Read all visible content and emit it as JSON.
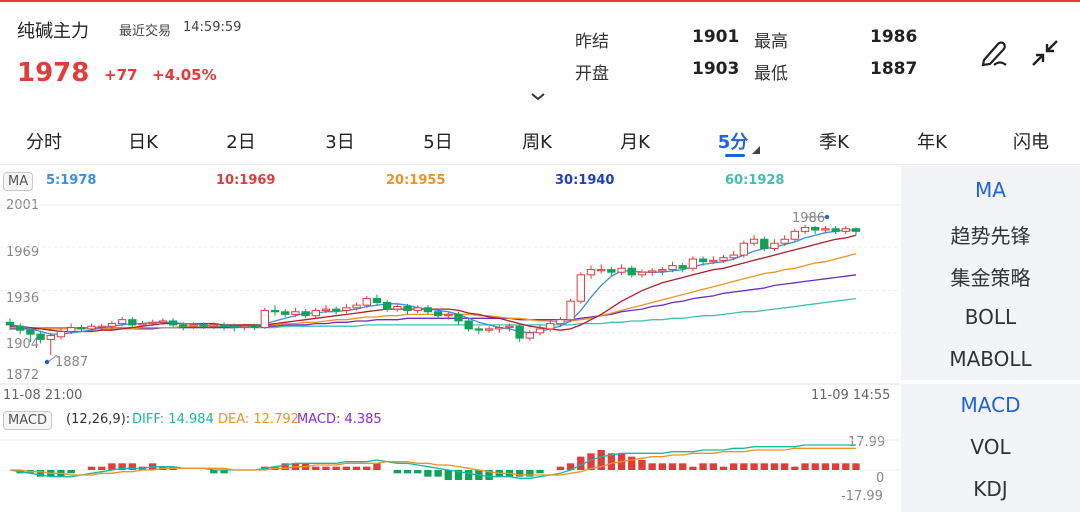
{
  "header": {
    "name": "纯碱主力",
    "trade_label": "最近交易",
    "trade_time": "14:59:59",
    "price": "1978",
    "change": "+77",
    "change_pct": "+4.05%",
    "stats": [
      {
        "label": "昨结",
        "value": "1901"
      },
      {
        "label": "最高",
        "value": "1986"
      },
      {
        "label": "开盘",
        "value": "1903"
      },
      {
        "label": "最低",
        "value": "1887"
      }
    ],
    "expand_icon": "chevron-down-icon",
    "draw_icon": "pen-draw-icon",
    "collapse_icon": "collapse-arrows-icon"
  },
  "tabs": [
    "分时",
    "日K",
    "2日",
    "3日",
    "5日",
    "周K",
    "月K",
    "5分",
    "季K",
    "年K",
    "闪电"
  ],
  "active_tab": "5分",
  "colors": {
    "up": "#e23b3b",
    "down": "#13a15a",
    "accent": "#1f63d8",
    "ma5": "#3a8fe0",
    "ma10": "#b01e2b",
    "ma20": "#ef9324",
    "ma30": "#6a2fc4",
    "ma60": "#3ec2b0"
  },
  "ma_legend": {
    "badge": "MA",
    "items": [
      {
        "label": "5:1978",
        "color": "#3a8fe0"
      },
      {
        "label": "10:1969",
        "color": "#e23b3b"
      },
      {
        "label": "20:1955",
        "color": "#ef9324"
      },
      {
        "label": "30:1940",
        "color": "#1f3fbf"
      },
      {
        "label": "60:1928",
        "color": "#3ec2b0"
      }
    ]
  },
  "price_axis": [
    "2001",
    "1969",
    "1936",
    "1904",
    "1872"
  ],
  "time_start": "11-08 21:00",
  "time_end": "11-09 14:55",
  "high_marker": "1986",
  "low_marker": "1887",
  "macd": {
    "badge": "MACD",
    "params": "(12,26,9):",
    "diff": "DIFF: 14.984",
    "dea": "DEA: 12.792",
    "macd": "MACD: 4.385",
    "axis": [
      "17.99",
      "0",
      "-17.99"
    ]
  },
  "side_menu_top": [
    "MA",
    "趋势先锋",
    "集金策略",
    "BOLL",
    "MABOLL"
  ],
  "side_menu_bottom": [
    "MACD",
    "VOL",
    "KDJ"
  ],
  "chart_data": {
    "type": "candlestick",
    "ylim": [
      1872,
      2001
    ],
    "candles": [
      [
        1912,
        1910,
        1915,
        1906
      ],
      [
        1909,
        1906,
        1911,
        1903
      ],
      [
        1906,
        1903,
        1908,
        1897
      ],
      [
        1903,
        1899,
        1905,
        1896
      ],
      [
        1899,
        1902,
        1904,
        1887
      ],
      [
        1901,
        1905,
        1907,
        1899
      ],
      [
        1905,
        1908,
        1911,
        1903
      ],
      [
        1908,
        1907,
        1910,
        1905
      ],
      [
        1907,
        1909,
        1911,
        1905
      ],
      [
        1909,
        1909,
        1911,
        1906
      ],
      [
        1909,
        1911,
        1913,
        1907
      ],
      [
        1911,
        1914,
        1916,
        1909
      ],
      [
        1914,
        1910,
        1916,
        1908
      ],
      [
        1910,
        1911,
        1913,
        1908
      ],
      [
        1911,
        1912,
        1914,
        1909
      ],
      [
        1912,
        1913,
        1915,
        1910
      ],
      [
        1913,
        1910,
        1915,
        1908
      ],
      [
        1910,
        1909,
        1912,
        1906
      ],
      [
        1909,
        1910,
        1912,
        1907
      ],
      [
        1910,
        1909,
        1912,
        1907
      ],
      [
        1909,
        1910,
        1912,
        1907
      ],
      [
        1910,
        1909,
        1912,
        1906
      ],
      [
        1909,
        1908,
        1911,
        1905
      ],
      [
        1908,
        1909,
        1911,
        1906
      ],
      [
        1909,
        1908,
        1911,
        1906
      ],
      [
        1908,
        1921,
        1923,
        1907
      ],
      [
        1921,
        1920,
        1925,
        1917
      ],
      [
        1920,
        1918,
        1922,
        1916
      ],
      [
        1918,
        1920,
        1923,
        1916
      ],
      [
        1920,
        1917,
        1922,
        1915
      ],
      [
        1917,
        1921,
        1923,
        1915
      ],
      [
        1921,
        1922,
        1925,
        1919
      ],
      [
        1922,
        1921,
        1924,
        1918
      ],
      [
        1921,
        1923,
        1926,
        1919
      ],
      [
        1923,
        1925,
        1927,
        1921
      ],
      [
        1925,
        1930,
        1932,
        1923
      ],
      [
        1930,
        1927,
        1933,
        1925
      ],
      [
        1927,
        1922,
        1929,
        1920
      ],
      [
        1922,
        1924,
        1926,
        1920
      ],
      [
        1924,
        1921,
        1926,
        1918
      ],
      [
        1921,
        1923,
        1925,
        1919
      ],
      [
        1923,
        1920,
        1925,
        1918
      ],
      [
        1920,
        1917,
        1922,
        1915
      ],
      [
        1917,
        1918,
        1920,
        1914
      ],
      [
        1918,
        1913,
        1920,
        1910
      ],
      [
        1913,
        1907,
        1915,
        1905
      ],
      [
        1907,
        1906,
        1909,
        1903
      ],
      [
        1906,
        1907,
        1909,
        1904
      ],
      [
        1907,
        1908,
        1910,
        1904
      ],
      [
        1908,
        1909,
        1911,
        1905
      ],
      [
        1909,
        1900,
        1911,
        1897
      ],
      [
        1900,
        1904,
        1906,
        1898
      ],
      [
        1904,
        1907,
        1910,
        1902
      ],
      [
        1907,
        1911,
        1913,
        1905
      ],
      [
        1911,
        1914,
        1916,
        1909
      ],
      [
        1914,
        1928,
        1930,
        1912
      ],
      [
        1928,
        1948,
        1950,
        1926
      ],
      [
        1948,
        1952,
        1955,
        1945
      ],
      [
        1952,
        1952,
        1956,
        1949
      ],
      [
        1952,
        1950,
        1954,
        1947
      ],
      [
        1950,
        1953,
        1956,
        1948
      ],
      [
        1953,
        1948,
        1955,
        1946
      ],
      [
        1948,
        1950,
        1952,
        1946
      ],
      [
        1950,
        1951,
        1953,
        1947
      ],
      [
        1951,
        1952,
        1954,
        1948
      ],
      [
        1952,
        1955,
        1958,
        1950
      ],
      [
        1955,
        1953,
        1957,
        1950
      ],
      [
        1953,
        1960,
        1962,
        1951
      ],
      [
        1960,
        1958,
        1962,
        1955
      ],
      [
        1958,
        1959,
        1962,
        1956
      ],
      [
        1959,
        1961,
        1963,
        1957
      ],
      [
        1961,
        1963,
        1966,
        1959
      ],
      [
        1963,
        1972,
        1974,
        1961
      ],
      [
        1972,
        1975,
        1978,
        1970
      ],
      [
        1975,
        1968,
        1977,
        1966
      ],
      [
        1968,
        1972,
        1975,
        1966
      ],
      [
        1972,
        1975,
        1978,
        1970
      ],
      [
        1975,
        1981,
        1983,
        1973
      ],
      [
        1981,
        1984,
        1986,
        1979
      ],
      [
        1984,
        1982,
        1985,
        1979
      ],
      [
        1982,
        1983,
        1985,
        1980
      ],
      [
        1983,
        1981,
        1985,
        1979
      ],
      [
        1981,
        1983,
        1985,
        1979
      ],
      [
        1983,
        1981,
        1984,
        1978
      ]
    ],
    "ma5": [
      1910,
      1909,
      1907,
      1905,
      1903,
      1903,
      1904,
      1905,
      1906,
      1908,
      1909,
      1910,
      1911,
      1911,
      1912,
      1912,
      1912,
      1911,
      1911,
      1910,
      1909,
      1909,
      1909,
      1909,
      1909,
      1911,
      1913,
      1915,
      1917,
      1919,
      1919,
      1920,
      1920,
      1921,
      1922,
      1924,
      1925,
      1926,
      1926,
      1925,
      1923,
      1922,
      1921,
      1920,
      1918,
      1915,
      1912,
      1910,
      1908,
      1907,
      1905,
      1904,
      1905,
      1907,
      1909,
      1913,
      1921,
      1931,
      1940,
      1947,
      1951,
      1951,
      1950,
      1950,
      1950,
      1951,
      1952,
      1954,
      1956,
      1957,
      1958,
      1960,
      1963,
      1966,
      1968,
      1969,
      1971,
      1973,
      1976,
      1978,
      1980,
      1981,
      1982,
      1982
    ],
    "ma10": [
      1909,
      1909,
      1908,
      1907,
      1906,
      1905,
      1905,
      1905,
      1905,
      1906,
      1906,
      1907,
      1908,
      1909,
      1910,
      1911,
      1911,
      1911,
      1911,
      1911,
      1911,
      1910,
      1910,
      1910,
      1910,
      1910,
      1911,
      1912,
      1913,
      1914,
      1915,
      1916,
      1917,
      1918,
      1919,
      1920,
      1921,
      1922,
      1922,
      1922,
      1922,
      1922,
      1922,
      1922,
      1921,
      1919,
      1918,
      1916,
      1915,
      1913,
      1911,
      1909,
      1908,
      1907,
      1906,
      1907,
      1910,
      1914,
      1918,
      1923,
      1928,
      1932,
      1936,
      1939,
      1942,
      1944,
      1946,
      1948,
      1950,
      1952,
      1953,
      1955,
      1957,
      1959,
      1961,
      1963,
      1965,
      1967,
      1969,
      1971,
      1973,
      1975,
      1976,
      1978
    ],
    "ma20": [
      1908,
      1908,
      1908,
      1908,
      1907,
      1907,
      1907,
      1907,
      1907,
      1907,
      1907,
      1907,
      1907,
      1908,
      1908,
      1908,
      1908,
      1909,
      1909,
      1909,
      1909,
      1909,
      1909,
      1910,
      1910,
      1910,
      1910,
      1911,
      1911,
      1912,
      1912,
      1913,
      1914,
      1914,
      1915,
      1916,
      1916,
      1917,
      1917,
      1918,
      1918,
      1918,
      1918,
      1918,
      1918,
      1918,
      1917,
      1917,
      1916,
      1915,
      1915,
      1914,
      1913,
      1913,
      1912,
      1913,
      1914,
      1915,
      1917,
      1919,
      1921,
      1923,
      1925,
      1927,
      1929,
      1931,
      1933,
      1935,
      1937,
      1939,
      1941,
      1943,
      1945,
      1947,
      1949,
      1950,
      1952,
      1953,
      1955,
      1957,
      1958,
      1960,
      1962,
      1964
    ],
    "ma30": [
      1907,
      1907,
      1907,
      1907,
      1907,
      1907,
      1907,
      1907,
      1907,
      1907,
      1907,
      1907,
      1907,
      1907,
      1907,
      1908,
      1908,
      1908,
      1908,
      1908,
      1908,
      1908,
      1908,
      1909,
      1909,
      1909,
      1909,
      1910,
      1910,
      1910,
      1911,
      1911,
      1912,
      1912,
      1913,
      1913,
      1914,
      1914,
      1914,
      1915,
      1915,
      1915,
      1915,
      1915,
      1915,
      1915,
      1915,
      1915,
      1915,
      1915,
      1914,
      1914,
      1914,
      1914,
      1914,
      1914,
      1915,
      1916,
      1917,
      1918,
      1920,
      1921,
      1922,
      1924,
      1925,
      1927,
      1928,
      1930,
      1931,
      1932,
      1934,
      1935,
      1936,
      1937,
      1938,
      1940,
      1941,
      1942,
      1943,
      1944,
      1945,
      1946,
      1947,
      1948
    ],
    "ma60": [
      1908,
      1908,
      1908,
      1908,
      1908,
      1908,
      1908,
      1908,
      1908,
      1908,
      1908,
      1908,
      1908,
      1908,
      1908,
      1908,
      1908,
      1908,
      1908,
      1908,
      1908,
      1908,
      1908,
      1908,
      1908,
      1908,
      1908,
      1909,
      1909,
      1909,
      1909,
      1909,
      1909,
      1909,
      1909,
      1910,
      1910,
      1910,
      1910,
      1910,
      1910,
      1910,
      1910,
      1910,
      1910,
      1910,
      1910,
      1910,
      1910,
      1910,
      1910,
      1910,
      1910,
      1910,
      1910,
      1910,
      1911,
      1911,
      1911,
      1912,
      1912,
      1913,
      1913,
      1914,
      1914,
      1915,
      1915,
      1916,
      1917,
      1917,
      1918,
      1919,
      1920,
      1920,
      1921,
      1922,
      1923,
      1924,
      1925,
      1926,
      1927,
      1928,
      1929,
      1930
    ],
    "macd_ylim": [
      -17.99,
      17.99
    ],
    "diff": [
      0,
      -1,
      -2,
      -3,
      -4,
      -4,
      -4,
      -3,
      -2,
      -1,
      0,
      1,
      1,
      1,
      2,
      2,
      2,
      1,
      1,
      1,
      0,
      0,
      0,
      0,
      0,
      1,
      2,
      3,
      4,
      4,
      4,
      4,
      4,
      5,
      5,
      5,
      6,
      5,
      4,
      4,
      3,
      2,
      1,
      0,
      -1,
      -2,
      -3,
      -4,
      -4,
      -4,
      -5,
      -5,
      -4,
      -3,
      -2,
      0,
      3,
      6,
      8,
      9,
      10,
      10,
      10,
      10,
      10,
      11,
      11,
      11,
      12,
      12,
      12,
      13,
      13,
      14,
      14,
      14,
      14,
      14,
      15,
      15,
      15,
      15,
      15,
      15
    ],
    "dea": [
      0,
      0,
      -1,
      -1,
      -2,
      -2,
      -3,
      -3,
      -3,
      -2,
      -2,
      -1,
      -1,
      0,
      0,
      1,
      1,
      1,
      1,
      1,
      1,
      1,
      0,
      0,
      0,
      0,
      1,
      1,
      2,
      2,
      3,
      3,
      3,
      4,
      4,
      4,
      4,
      5,
      5,
      5,
      4,
      4,
      3,
      3,
      2,
      1,
      0,
      -1,
      -2,
      -2,
      -3,
      -3,
      -3,
      -3,
      -3,
      -2,
      -1,
      1,
      2,
      4,
      5,
      6,
      7,
      8,
      8,
      9,
      9,
      10,
      10,
      10,
      11,
      11,
      11,
      12,
      12,
      12,
      12,
      13,
      13,
      13,
      13,
      13,
      13,
      13
    ],
    "macd": [
      0,
      -2,
      -2,
      -4,
      -4,
      -4,
      -2,
      0,
      2,
      2,
      4,
      4,
      4,
      2,
      4,
      2,
      2,
      0,
      0,
      0,
      -2,
      -2,
      0,
      0,
      0,
      2,
      2,
      4,
      4,
      4,
      2,
      2,
      2,
      2,
      2,
      2,
      4,
      0,
      -2,
      -2,
      -2,
      -4,
      -4,
      -6,
      -6,
      -6,
      -6,
      -6,
      -4,
      -4,
      -4,
      -4,
      -2,
      0,
      2,
      4,
      8,
      10,
      12,
      10,
      10,
      8,
      6,
      4,
      4,
      4,
      4,
      2,
      4,
      4,
      2,
      4,
      4,
      4,
      4,
      4,
      4,
      2,
      4,
      4,
      4,
      4,
      4,
      4
    ]
  }
}
